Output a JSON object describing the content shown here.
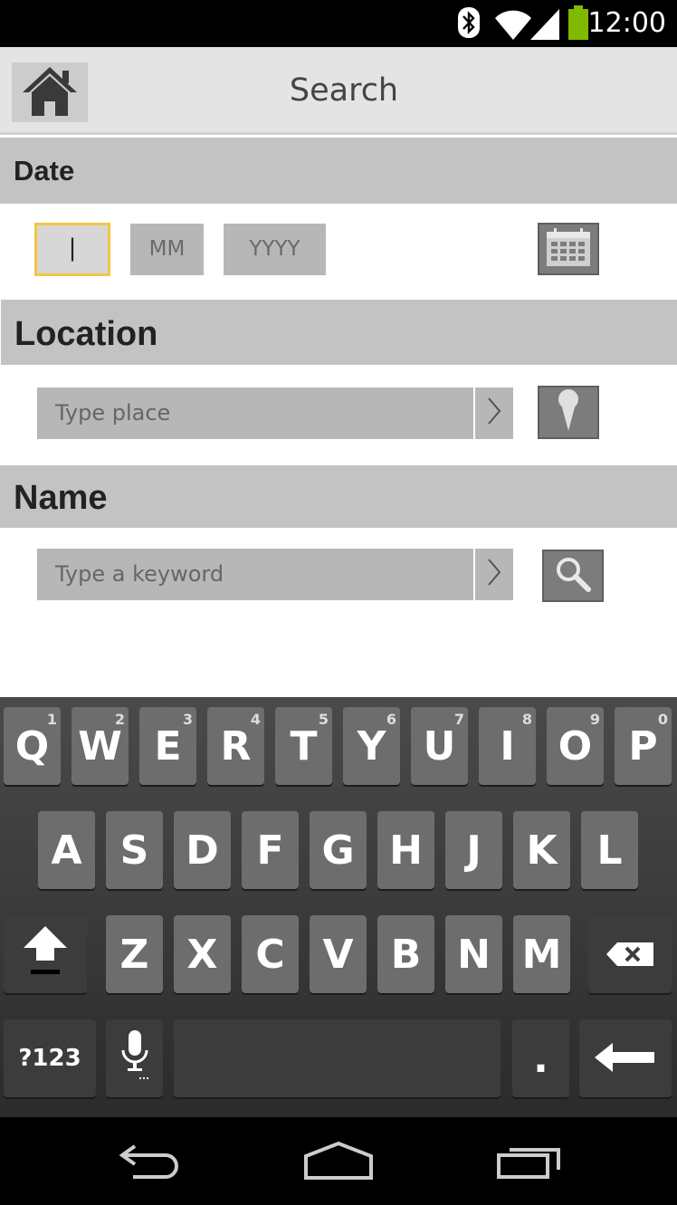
{
  "status_bar": {
    "time": "12:00",
    "icons": [
      "bluetooth-icon",
      "wifi-icon",
      "signal-icon",
      "battery-icon"
    ],
    "battery_color": "#7fba00"
  },
  "action_bar": {
    "title": "Search",
    "home_icon": "home-icon"
  },
  "sections": {
    "date": {
      "label": "Date",
      "day_value": "|",
      "month_placeholder": "MM",
      "year_placeholder": "YYYY",
      "icon": "calendar-icon"
    },
    "location": {
      "label": "Location",
      "placeholder": "Type place",
      "go_icon": "chevron-right-icon",
      "icon": "map-pin-icon"
    },
    "name": {
      "label": "Name",
      "placeholder": "Type a keyword",
      "go_icon": "chevron-right-icon",
      "icon": "search-icon"
    }
  },
  "keyboard": {
    "row1": [
      {
        "label": "Q",
        "sup": "1"
      },
      {
        "label": "W",
        "sup": "2"
      },
      {
        "label": "E",
        "sup": "3"
      },
      {
        "label": "R",
        "sup": "4"
      },
      {
        "label": "T",
        "sup": "5"
      },
      {
        "label": "Y",
        "sup": "6"
      },
      {
        "label": "U",
        "sup": "7"
      },
      {
        "label": "I",
        "sup": "8"
      },
      {
        "label": "O",
        "sup": "9"
      },
      {
        "label": "P",
        "sup": "0"
      }
    ],
    "row2": [
      "A",
      "S",
      "D",
      "F",
      "G",
      "H",
      "J",
      "K",
      "L"
    ],
    "row3": [
      "Z",
      "X",
      "C",
      "V",
      "B",
      "N",
      "M"
    ],
    "symbols_label": "?123",
    "period_label": ".",
    "shift_icon": "shift-icon",
    "backspace_icon": "backspace-icon",
    "mic_icon": "microphone-icon",
    "enter_icon": "enter-icon"
  },
  "nav_bar": {
    "buttons": [
      "back-icon",
      "home-icon",
      "recent-apps-icon"
    ]
  },
  "colors": {
    "section_header": "#c3c3c3",
    "field": "#b7b7b7",
    "focus_border": "#f5c542",
    "icon_button": "#7c7c7c",
    "key": "#6d6d6d"
  }
}
